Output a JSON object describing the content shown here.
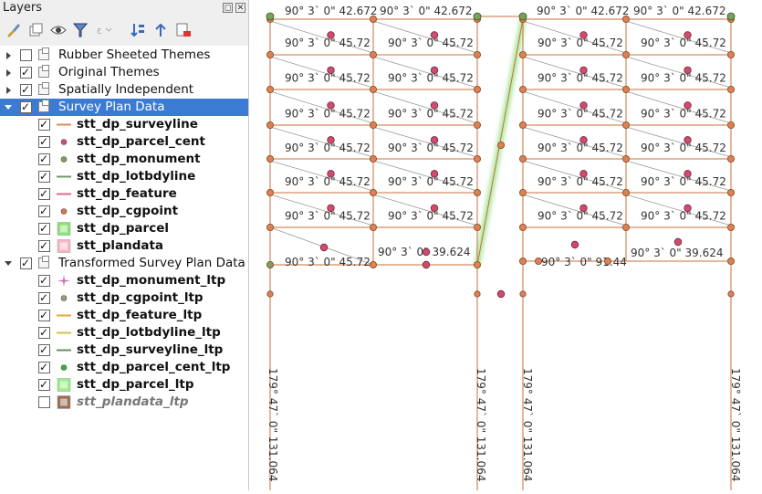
{
  "panel": {
    "title": "Layers"
  },
  "layers": [
    {
      "label": "Rubber Sheeted Themes",
      "kind": "group",
      "expanded": false,
      "checked": false,
      "bold": false
    },
    {
      "label": "Original Themes",
      "kind": "group",
      "expanded": false,
      "checked": true,
      "bold": false
    },
    {
      "label": "Spatially Independent",
      "kind": "group",
      "expanded": false,
      "checked": true,
      "bold": false
    },
    {
      "label": "Survey Plan Data",
      "kind": "group",
      "expanded": true,
      "checked": true,
      "bold": false,
      "selected": true
    },
    {
      "label": "stt_dp_surveyline",
      "kind": "layer",
      "checked": true,
      "symbol": "line",
      "color": "#e8875a",
      "bold": true
    },
    {
      "label": "stt_dp_parcel_cent",
      "kind": "layer",
      "checked": true,
      "symbol": "dot",
      "color": "#d44a6e",
      "bold": true
    },
    {
      "label": "stt_dp_monument",
      "kind": "layer",
      "checked": true,
      "symbol": "dot",
      "color": "#7aa05a",
      "bold": true
    },
    {
      "label": "stt_dp_lotbdyline",
      "kind": "layer",
      "checked": true,
      "symbol": "line",
      "color": "#6f9a6f",
      "bold": true
    },
    {
      "label": "stt_dp_feature",
      "kind": "layer",
      "checked": true,
      "symbol": "line",
      "color": "#e0688c",
      "bold": true
    },
    {
      "label": "stt_dp_cgpoint",
      "kind": "layer",
      "checked": true,
      "symbol": "dot",
      "color": "#e0704a",
      "bold": true
    },
    {
      "label": "stt_dp_parcel",
      "kind": "layer",
      "checked": true,
      "symbol": "fill",
      "color": "#8ee07a",
      "bold": true
    },
    {
      "label": "stt_plandata",
      "kind": "layer",
      "checked": true,
      "symbol": "fill",
      "color": "#f5b7c4",
      "bold": true
    },
    {
      "label": "Transformed Survey Plan Data",
      "kind": "group",
      "expanded": true,
      "checked": true,
      "bold": false
    },
    {
      "label": "stt_dp_monument_ltp",
      "kind": "layer",
      "checked": true,
      "symbol": "star",
      "color": "#d06aa8",
      "bold": true
    },
    {
      "label": "stt_dp_cgpoint_ltp",
      "kind": "layer",
      "checked": true,
      "symbol": "dot",
      "color": "#9a9a7a",
      "bold": true
    },
    {
      "label": "stt_dp_feature_ltp",
      "kind": "layer",
      "checked": true,
      "symbol": "line",
      "color": "#e6a83a",
      "bold": true
    },
    {
      "label": "stt_dp_lotbdyline_ltp",
      "kind": "layer",
      "checked": true,
      "symbol": "line",
      "color": "#c8c846",
      "bold": true
    },
    {
      "label": "stt_dp_surveyline_ltp",
      "kind": "layer",
      "checked": true,
      "symbol": "line",
      "color": "#6f8a6f",
      "bold": true
    },
    {
      "label": "stt_dp_parcel_cent_ltp",
      "kind": "layer",
      "checked": true,
      "symbol": "dot",
      "color": "#2fb82f",
      "bold": true
    },
    {
      "label": "stt_dp_parcel_ltp",
      "kind": "layer",
      "checked": true,
      "symbol": "fill",
      "color": "#9aee8a",
      "bold": true
    },
    {
      "label": "stt_plandata_ltp",
      "kind": "layer",
      "checked": false,
      "symbol": "fill",
      "color": "#9a6a52",
      "bold": true,
      "muted": true
    }
  ],
  "map": {
    "top_labels": [
      "90° 3` 0\" 42.672",
      "90° 3` 0\" 42.672",
      "90° 3` 0\" 42.672",
      "90° 3` 0\" 42.672"
    ],
    "lot_label": "90° 3` 0\" 45.72",
    "bottom_left_label": "90° 3` 0\" 45.72",
    "bottom_mid_left_label": "90° 3` 0\" 39.624",
    "bottom_mid_right_label": "90° 3` 0\" 91.44",
    "bottom_right_label": "90° 3` 0\" 39.624",
    "vertical_label": "179° 47` 0\" 131.064",
    "colors": {
      "line": "#c8703a",
      "point": "#e08050",
      "centroid": "#d44a6e",
      "glow": "#7fdc6a"
    }
  }
}
